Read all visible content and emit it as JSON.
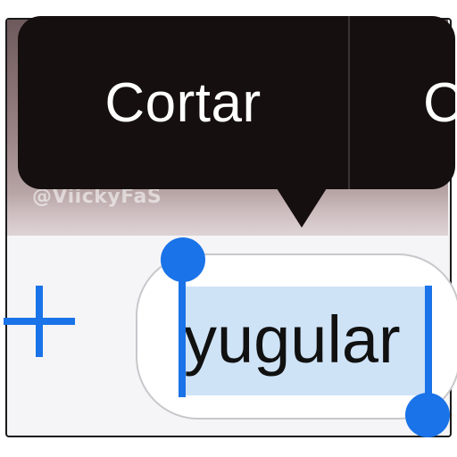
{
  "context_menu": {
    "items": [
      {
        "label": "Cortar"
      },
      {
        "label": "C"
      }
    ]
  },
  "watermark": {
    "text": "@ViickyFaS"
  },
  "compose_bar": {
    "add_icon": "plus-icon",
    "text_field": {
      "value": "yugular",
      "selected_text": "yugular"
    }
  },
  "colors": {
    "accent": "#1a73e8",
    "menu_background": "#150f0f",
    "selection": "#cfe3f7"
  }
}
